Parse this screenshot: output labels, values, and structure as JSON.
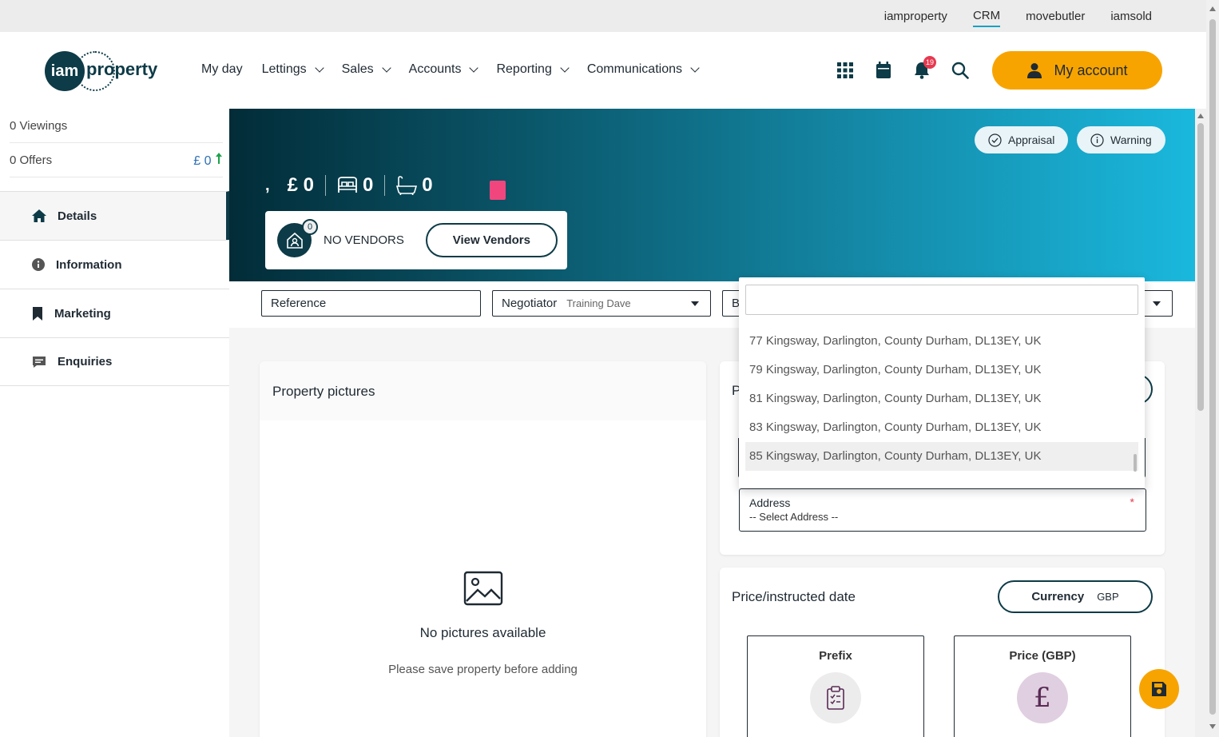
{
  "topbar": {
    "links": [
      "iamproperty",
      "CRM",
      "movebutler",
      "iamsold"
    ],
    "active": "CRM"
  },
  "logo": {
    "mark": "iam",
    "word": "property"
  },
  "nav": {
    "items": [
      {
        "label": "My day",
        "dropdown": false
      },
      {
        "label": "Lettings",
        "dropdown": true
      },
      {
        "label": "Sales",
        "dropdown": true
      },
      {
        "label": "Accounts",
        "dropdown": true
      },
      {
        "label": "Reporting",
        "dropdown": true
      },
      {
        "label": "Communications",
        "dropdown": true
      }
    ]
  },
  "header_icons": {
    "apps": "grid-icon",
    "calendar": "calendar-icon",
    "notifications": "bell-icon",
    "notification_count": "19",
    "search": "search-icon"
  },
  "account": {
    "label": "My account",
    "icon": "user-icon"
  },
  "sidebar": {
    "viewings": "0 Viewings",
    "offers": "0 Offers",
    "offers_value": "£ 0",
    "items": [
      {
        "label": "Details",
        "icon": "home-icon",
        "active": true
      },
      {
        "label": "Information",
        "icon": "info-icon",
        "active": false
      },
      {
        "label": "Marketing",
        "icon": "bookmark-icon",
        "active": false
      },
      {
        "label": "Enquiries",
        "icon": "chat-icon",
        "active": false
      }
    ]
  },
  "hero": {
    "appraisal": "Appraisal",
    "warning": "Warning",
    "address": ",",
    "price": "£ 0",
    "beds": "0",
    "baths": "0",
    "vendors_count": "0",
    "vendors_text": "NO VENDORS",
    "view_vendors": "View Vendors",
    "status_color": "#f0467d"
  },
  "filters": {
    "reference": "Reference",
    "negotiator_label": "Negotiator",
    "negotiator_value": "Training Dave",
    "branch_label": "B"
  },
  "pictures": {
    "title": "Property pictures",
    "empty_title": "No pictures available",
    "empty_sub": "Please save property before adding"
  },
  "property_card": {
    "title_initial": "P",
    "address_label": "Address",
    "address_placeholder": "-- Select Address --",
    "required": "*"
  },
  "dropdown": {
    "search_value": "",
    "options": [
      "77 Kingsway, Darlington, County Durham, DL13EY, UK",
      "79 Kingsway, Darlington, County Durham, DL13EY, UK",
      "81 Kingsway, Darlington, County Durham, DL13EY, UK",
      "83 Kingsway, Darlington, County Durham, DL13EY, UK",
      "85 Kingsway, Darlington, County Durham, DL13EY, UK"
    ],
    "highlighted": 4
  },
  "price_card": {
    "title": "Price/instructed date",
    "currency_label": "Currency",
    "currency_value": "GBP",
    "prefix_label": "Prefix",
    "price_label": "Price (GBP)",
    "pound_symbol": "£"
  },
  "colors": {
    "brand_dark": "#0d3b47",
    "accent": "#f7a400",
    "link": "#17a2c4"
  }
}
